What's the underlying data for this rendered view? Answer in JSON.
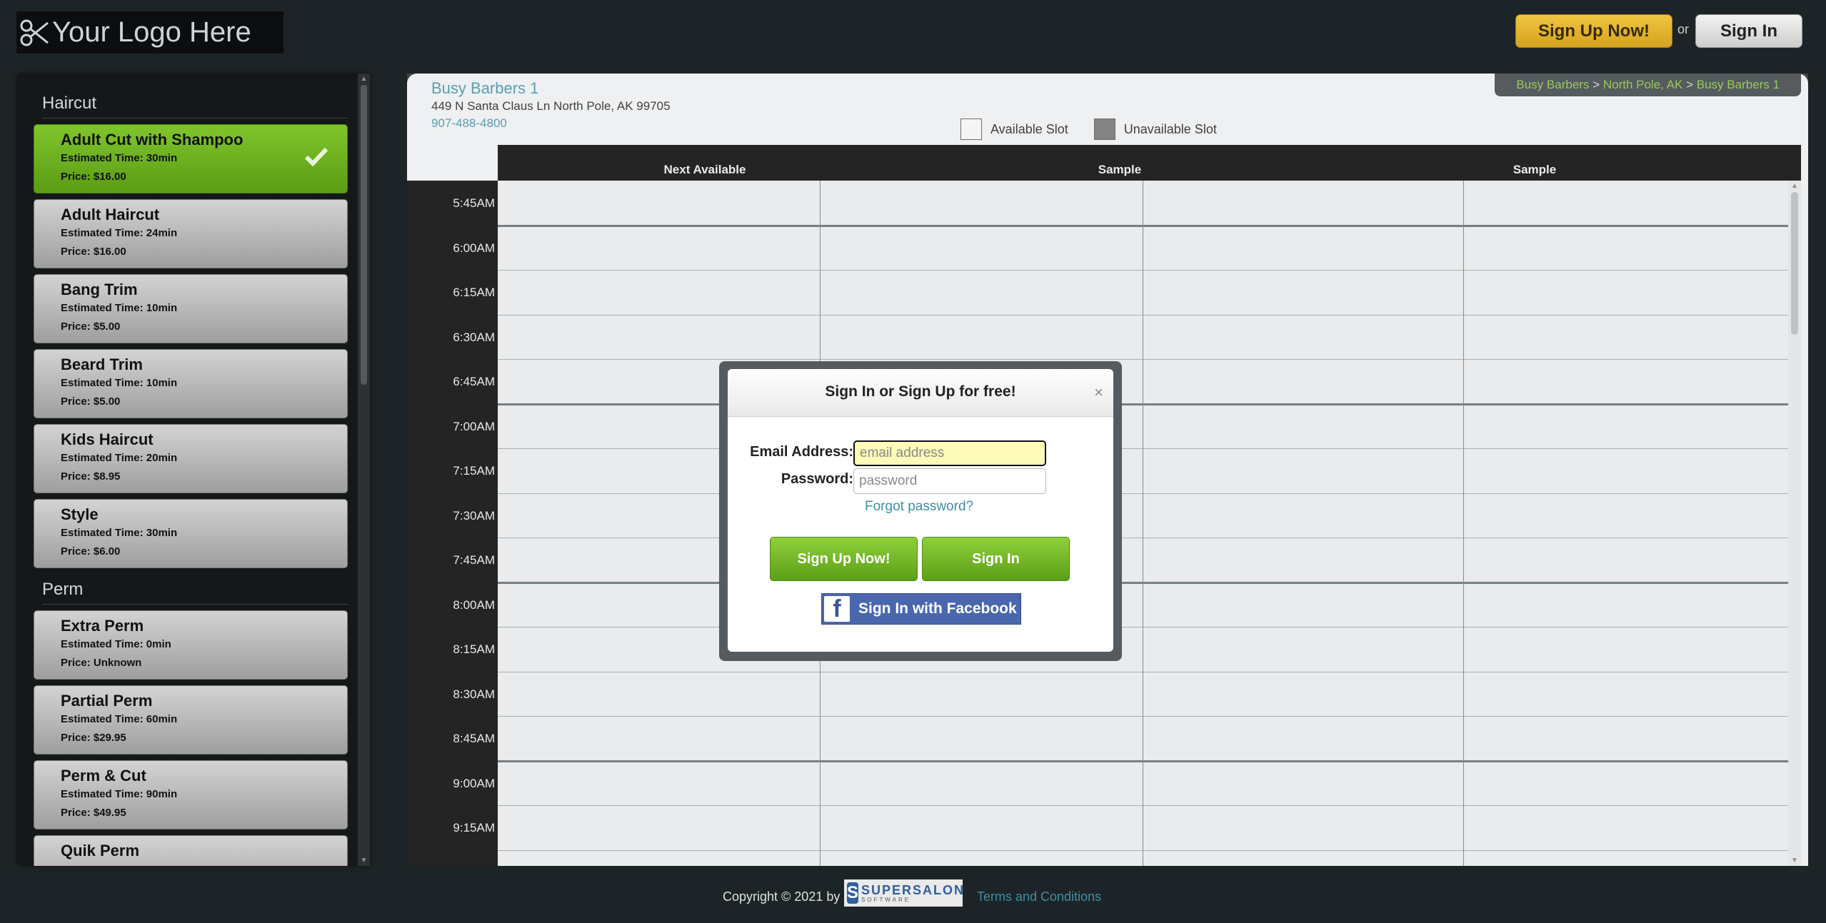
{
  "header": {
    "logo_text": "Your Logo Here",
    "signup_label": "Sign Up Now!",
    "or_text": "or",
    "signin_label": "Sign In"
  },
  "sidebar": {
    "categories": [
      {
        "name": "Haircut",
        "services": [
          {
            "name": "Adult Cut with Shampoo",
            "time": "Estimated Time: 30min",
            "price": "Price: $16.00",
            "selected": true
          },
          {
            "name": "Adult Haircut",
            "time": "Estimated Time: 24min",
            "price": "Price: $16.00"
          },
          {
            "name": "Bang Trim",
            "time": "Estimated Time: 10min",
            "price": "Price: $5.00"
          },
          {
            "name": "Beard Trim",
            "time": "Estimated Time: 10min",
            "price": "Price: $5.00"
          },
          {
            "name": "Kids Haircut",
            "time": "Estimated Time: 20min",
            "price": "Price: $8.95"
          },
          {
            "name": "Style",
            "time": "Estimated Time: 30min",
            "price": "Price: $6.00"
          }
        ]
      },
      {
        "name": "Perm",
        "services": [
          {
            "name": "Extra Perm",
            "time": "Estimated Time: 0min",
            "price": "Price: Unknown"
          },
          {
            "name": "Partial Perm",
            "time": "Estimated Time: 60min",
            "price": "Price: $29.95"
          },
          {
            "name": "Perm & Cut",
            "time": "Estimated Time: 90min",
            "price": "Price: $49.95"
          },
          {
            "name": "Quik Perm",
            "time": "",
            "price": ""
          }
        ]
      }
    ]
  },
  "salon": {
    "name": "Busy Barbers 1",
    "address": "449 N Santa Claus Ln North Pole, AK 99705",
    "phone": "907-488-4800"
  },
  "breadcrumb": {
    "items": [
      "Busy Barbers",
      "North Pole, AK",
      "Busy Barbers 1"
    ],
    "separator": ">"
  },
  "legend": {
    "available": "Available Slot",
    "unavailable": "Unavailable Slot"
  },
  "calendar": {
    "columns": [
      "Next Available",
      "Sample",
      "Sample"
    ],
    "times": [
      "5:45AM",
      "6:00AM",
      "6:15AM",
      "6:30AM",
      "6:45AM",
      "7:00AM",
      "7:15AM",
      "7:30AM",
      "7:45AM",
      "8:00AM",
      "8:15AM",
      "8:30AM",
      "8:45AM",
      "9:00AM",
      "9:15AM"
    ]
  },
  "modal": {
    "title": "Sign In or Sign Up for free!",
    "close_glyph": "×",
    "email_label": "Email Address:",
    "email_placeholder": "email address",
    "password_label": "Password:",
    "password_placeholder": "password",
    "forgot": "Forgot password?",
    "signup_label": "Sign Up Now!",
    "signin_label": "Sign In",
    "facebook_label": "Sign In with Facebook",
    "facebook_icon_glyph": "f"
  },
  "footer": {
    "copyright": "Copyright © 2021 by",
    "brand_name": "SUPERSALON",
    "brand_sub": "SOFTWARE",
    "brand_mark": "S",
    "terms": "Terms and Conditions"
  },
  "colors": {
    "accent_teal": "#3f8ea5",
    "green": "#6eb524",
    "gold": "#e0b02a",
    "breadcrumb_green": "#88c33f"
  },
  "icons": [
    "scissors-icon",
    "checkmark-icon",
    "close-icon",
    "facebook-icon",
    "supersalon-logo-icon"
  ]
}
